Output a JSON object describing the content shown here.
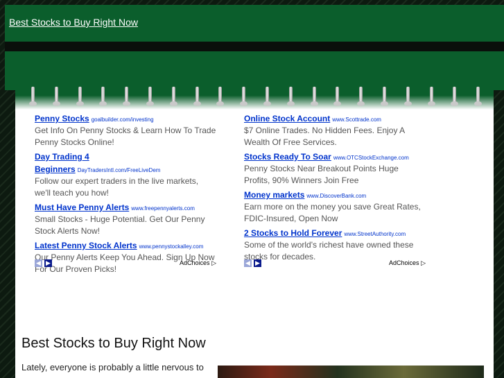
{
  "header": {
    "site_title": "Best Stocks to Buy Right Now"
  },
  "ads_left": [
    {
      "title": "Penny Stocks",
      "url": "goalbuilder.com/investing",
      "desc": "Get Info On Penny Stocks & Learn How To Trade Penny Stocks Online!"
    },
    {
      "title": "Day Trading 4 Beginners",
      "url": "DayTradersIntl.com/FreeLiveDem",
      "desc": "Follow our expert traders in the live markets, we'll teach you how!"
    },
    {
      "title": "Must Have Penny Alerts",
      "url": "www.freepennyalerts.com",
      "desc": "Small Stocks - Huge Potential. Get Our Penny Stock Alerts Now!"
    },
    {
      "title": "Latest Penny Stock Alerts",
      "url": "www.pennystockalley.com",
      "desc": "Our Penny Alerts Keep You Ahead. Sign Up Now For Our Proven Picks!"
    }
  ],
  "ads_right": [
    {
      "title": "Online Stock Account",
      "url": "www.Scottrade.com",
      "desc": "$7 Online Trades. No Hidden Fees. Enjoy A Wealth Of Free Services."
    },
    {
      "title": "Stocks Ready To Soar",
      "url": "www.OTCStockExchange.com",
      "desc": "Penny Stocks Near Breakout Points Huge Profits, 90% Winners Join Free"
    },
    {
      "title": "Money markets",
      "url": "www.DiscoverBank.com",
      "desc": "Earn more on the money you save Great Rates, FDIC-Insured, Open Now"
    },
    {
      "title": "2 Stocks to Hold Forever",
      "url": "www.StreetAuthority.com",
      "desc": "Some of the world's richest have owned these stocks for decades."
    }
  ],
  "adchoices_label": "AdChoices",
  "main": {
    "title": "Best Stocks to Buy Right Now",
    "text": "Lately, everyone is probably a little nervous to"
  },
  "colors": {
    "header_green": "#0b5e2c",
    "ad_link": "#0033cc"
  }
}
